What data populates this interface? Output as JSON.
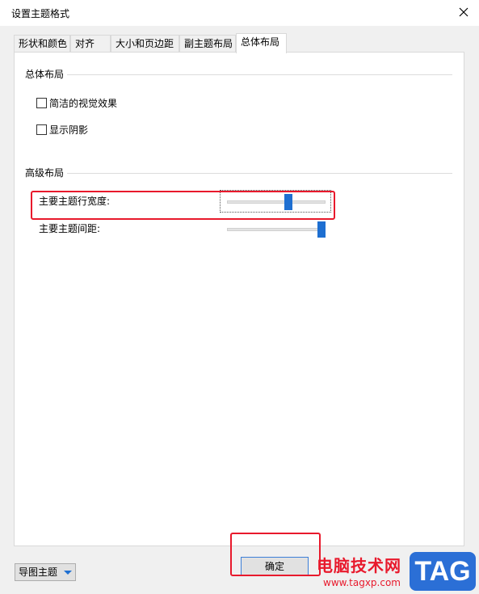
{
  "window": {
    "title": "设置主题格式"
  },
  "tabs": [
    {
      "label": "形状和颜色"
    },
    {
      "label": "对齐"
    },
    {
      "label": "大小和页边距"
    },
    {
      "label": "副主题布局"
    },
    {
      "label": "总体布局"
    }
  ],
  "active_tab": "总体布局",
  "overall_layout": {
    "title": "总体布局",
    "options": [
      {
        "label": "简洁的视觉效果",
        "checked": false
      },
      {
        "label": "显示阴影",
        "checked": false
      }
    ]
  },
  "advanced_layout": {
    "title": "高级布局",
    "row_width": {
      "label": "主要主题行宽度:",
      "value_fraction": 0.63
    },
    "spacing": {
      "label": "主要主题间距:",
      "value_fraction": 1.0
    }
  },
  "footer": {
    "dropdown_label": "导图主题",
    "ok_label": "确定"
  },
  "watermark": {
    "text": "电脑技术网",
    "url": "www.tagxp.com",
    "badge": "TAG"
  },
  "colors": {
    "accent": "#1e6fd1",
    "highlight": "#e8192c"
  },
  "icons": {
    "close": "close-icon",
    "dropdown": "chevron-down-icon"
  }
}
